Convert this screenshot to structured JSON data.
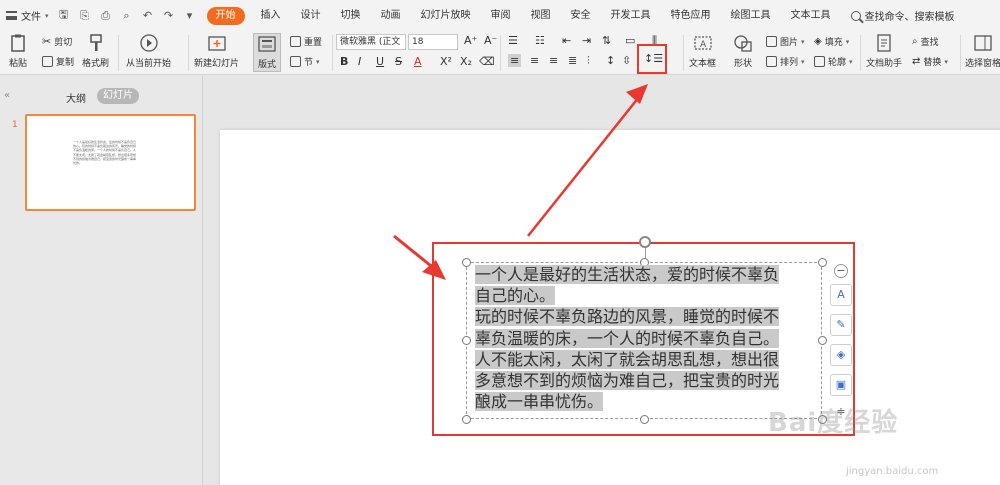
{
  "menubar": {
    "file_label": "文件",
    "tabs": [
      "开始",
      "插入",
      "设计",
      "切换",
      "动画",
      "幻灯片放映",
      "审阅",
      "视图",
      "安全",
      "开发工具",
      "特色应用",
      "绘图工具",
      "文本工具"
    ],
    "active_tab": "开始",
    "search_label": "查找命令、搜索模板"
  },
  "ribbon": {
    "paste": "粘贴",
    "cut": "剪切",
    "copy": "复制",
    "format_painter": "格式刷",
    "from_current": "从当前开始",
    "new_slide": "新建幻灯片",
    "layout": "版式",
    "reset": "重置",
    "section": "节",
    "font_name": "微软雅黑 (正文",
    "font_size": "18",
    "textbox": "文本框",
    "shape": "形状",
    "picture": "图片",
    "fill": "填充",
    "arrange": "排列",
    "outline": "轮廓",
    "doc_helper": "文档助手",
    "find": "查找",
    "replace": "替换",
    "select_pane": "选择窗格"
  },
  "left_panel": {
    "outline_tab": "大纲",
    "slides_tab": "幻灯片",
    "slide_number": "1",
    "thumb_text": "一个人是最好的生活状态，爱的时候不辜负自己的心。玩的时候不辜负路边的风景，睡觉的时候不辜负温暖的床，一个人的时候不辜负自己。人不能太闲，太闲了就会胡思乱想，想出很多意想不到的烦恼为难自己，把宝贵的时光酿成一串串忧伤。"
  },
  "slide": {
    "lines": [
      "一个人是最好的生活状态，爱的时候不辜负",
      "自己的心。",
      "玩的时候不辜负路边的风景，睡觉的时候不",
      "辜负温暖的床，一个人的时候不辜负自己。",
      "人不能太闲，太闲了就会胡思乱想，想出很",
      "多意想不到的烦恼为难自己，把宝贵的时光",
      "酿成一串串忧伤。"
    ]
  },
  "watermark": {
    "brand": "Bai度经验",
    "url": "jingyan.baidu.com"
  },
  "colors": {
    "accent": "#f56b1e",
    "annotation_red": "#e03a31",
    "selection_highlight": "#c9c9c9"
  }
}
